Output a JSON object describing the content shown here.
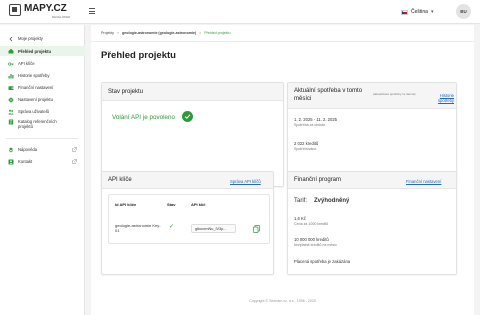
{
  "topbar": {
    "logo_text": "MAPY.CZ",
    "logo_sub": "DEVELOPER",
    "language": "Čeština",
    "avatar_initials": "BU"
  },
  "sidebar": {
    "back_label": "Moje projekty",
    "items": [
      {
        "label": "Přehled projektu",
        "icon": "home-icon",
        "active": true
      },
      {
        "label": "API klíče",
        "icon": "key-icon",
        "active": false
      },
      {
        "label": "Historie spotřeby",
        "icon": "bar-chart-icon",
        "active": false
      },
      {
        "label": "Finanční nastavení",
        "icon": "wallet-icon",
        "active": false
      },
      {
        "label": "Nastavení projektu",
        "icon": "gear-icon",
        "active": false
      },
      {
        "label": "Správa uživatelů",
        "icon": "users-icon",
        "active": false
      },
      {
        "label": "Katalog referenčních projektů",
        "icon": "catalog-icon",
        "active": false
      }
    ],
    "help_label": "Nápověda",
    "contact_label": "Kontakt"
  },
  "breadcrumb": {
    "items": [
      "Projekty",
      "geologie-astronomie (geologie-astronomie)",
      "Přehled projektu"
    ]
  },
  "page_title": "Přehled projektu",
  "project_status": {
    "title": "Stav projektu",
    "status_text": "Volání API je povoleno",
    "status_color": "#2e9b3a"
  },
  "consumption": {
    "title": "Aktuální spotřeba v tomto měsíci",
    "note": "(aktualizace spotřeby 1x denně)",
    "history_link": "Historie spotřeby",
    "period": "1. 2. 2025 - 11. 2. 2025",
    "period_caption": "Spotřeba za období",
    "credits": "2 022 kreditů",
    "credits_caption": "Spotřebováno"
  },
  "api_keys": {
    "title": "API klíče",
    "manage_link": "Správa API klíčů",
    "columns": [
      "Id API klíče",
      "Stav",
      "API klíč"
    ],
    "rows": [
      {
        "id": "geologie-astronomie Key-01",
        "key": "gtkuxrmNu_IV3p..."
      }
    ]
  },
  "finance": {
    "title": "Finanční program",
    "settings_link": "Finanční nastavení",
    "tariff_label": "Tarif:",
    "tariff_value": "Zvýhodněný",
    "price": "1,6 Kč",
    "price_caption": "Cena za 1000 kreditů",
    "free_credits": "10 000 000 kreditů",
    "free_caption": "bezplatně kreditů na měsíc",
    "paid_note": "Placená spotřeba je zakázána"
  },
  "footer": {
    "copyright": "Copyright © Seznam.cz, a.s., 1996 - 2025"
  }
}
